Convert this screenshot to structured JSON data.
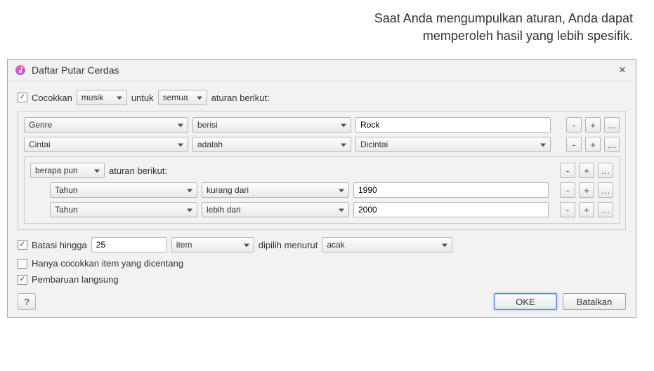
{
  "caption": {
    "line1": "Saat Anda mengumpulkan aturan, Anda dapat",
    "line2": "memperoleh hasil yang lebih spesifik."
  },
  "window": {
    "title": "Daftar Putar Cerdas",
    "close_glyph": "✕"
  },
  "match": {
    "checkbox_checked": true,
    "label": "Cocokkan",
    "media_select": "musik",
    "for_label": "untuk",
    "allany_select": "semua",
    "suffix": "aturan berikut:"
  },
  "rules": [
    {
      "field": "Genre",
      "op": "berisi",
      "value_type": "text",
      "value": "Rock"
    },
    {
      "field": "Cintai",
      "op": "adalah",
      "value_type": "select",
      "value": "Dicintai"
    }
  ],
  "nested": {
    "mode": "berapa pun",
    "suffix": "aturan berikut:",
    "rules": [
      {
        "field": "Tahun",
        "op": "kurang dari",
        "value": "1990"
      },
      {
        "field": "Tahun",
        "op": "lebih dari",
        "value": "2000"
      }
    ]
  },
  "limit": {
    "checked": true,
    "label": "Batasi hingga",
    "value": "25",
    "unit": "item",
    "by_label": "dipilih menurut",
    "by_value": "acak"
  },
  "only_checked": {
    "checked": false,
    "label": "Hanya cocokkan item yang dicentang"
  },
  "live_update": {
    "checked": true,
    "label": "Pembaruan langsung"
  },
  "buttons": {
    "help": "?",
    "ok": "OKE",
    "cancel": "Batalkan",
    "minus": "-",
    "plus": "+",
    "ellipsis": "…"
  },
  "glyphs": {
    "check": "✓"
  }
}
